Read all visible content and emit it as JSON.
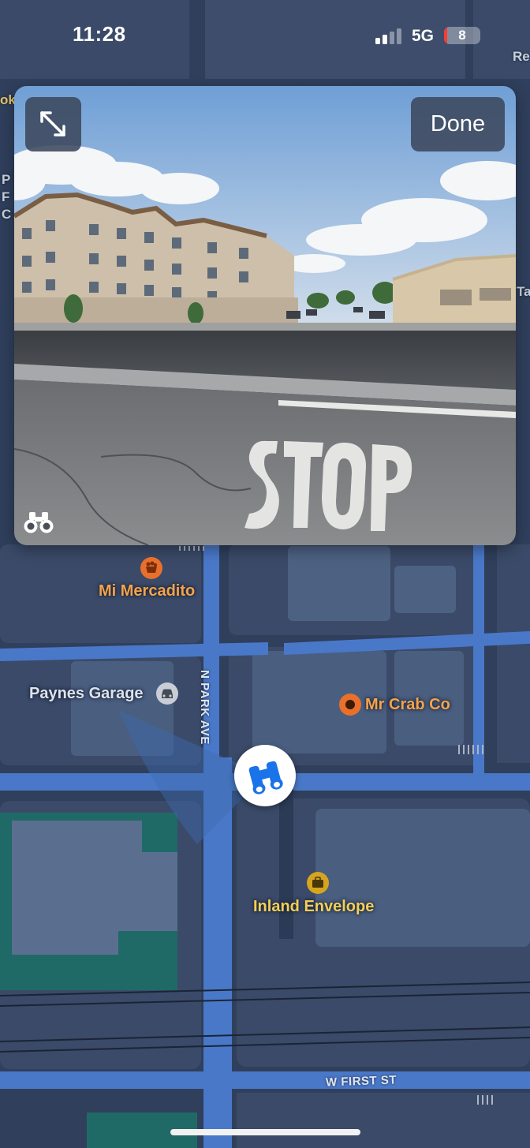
{
  "status_bar": {
    "time": "11:28",
    "network": "5G",
    "battery": "8"
  },
  "look_around": {
    "done_label": "Done"
  },
  "map": {
    "pois": [
      {
        "name": "Mi Mercadito",
        "category": "grocery-icon",
        "color": "#e8702a"
      },
      {
        "name": "Paynes Garage",
        "category": "car-repair-icon",
        "color": "#c9ced6"
      },
      {
        "name": "Mr Crab Co",
        "category": "restaurant-icon",
        "color": "#e8702a"
      },
      {
        "name": "Inland Envelope",
        "category": "briefcase-icon",
        "color": "#d6a51f"
      }
    ],
    "streets": {
      "vertical": "N PARK AVE",
      "horizontal": "W FIRST ST"
    },
    "edge_text": {
      "top_left": "ok",
      "right_top": "Re",
      "right_mid": "Ta",
      "left_letters": [
        "P",
        "F",
        "C"
      ]
    }
  },
  "colors": {
    "map_bg": "#2f3f5c",
    "road": "#4a78c8",
    "park": "#1f6a66",
    "accent": "#1a73e8"
  }
}
